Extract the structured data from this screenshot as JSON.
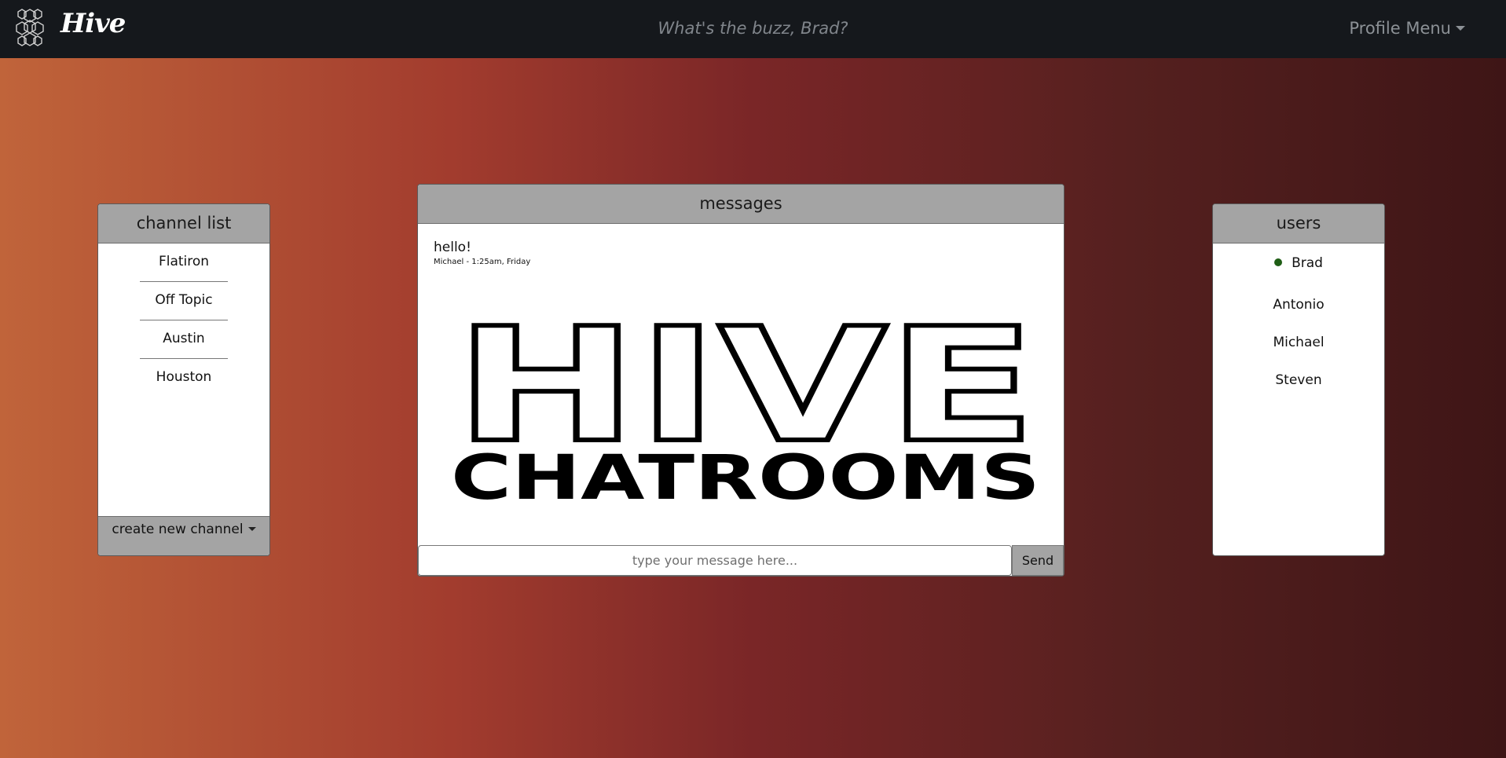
{
  "navbar": {
    "brand": "Hive",
    "tagline": "What's the buzz, Brad?",
    "profile_menu": "Profile Menu"
  },
  "channels": {
    "title": "channel list",
    "items": [
      "Flatiron",
      "Off Topic",
      "Austin",
      "Houston"
    ],
    "create_label": "create new channel"
  },
  "messages": {
    "title": "messages",
    "items": [
      {
        "text": "hello!",
        "meta": "Michael - 1:25am, Friday"
      }
    ],
    "logo": {
      "line1": "HIVE",
      "line2": "CHATROOMS"
    },
    "input_placeholder": "type your message here...",
    "send_label": "Send"
  },
  "users": {
    "title": "users",
    "items": [
      {
        "name": "Brad",
        "online": true
      },
      {
        "name": "Antonio",
        "online": false
      },
      {
        "name": "Michael",
        "online": false
      },
      {
        "name": "Steven",
        "online": false
      }
    ]
  },
  "colors": {
    "navbar_bg": "#15181c",
    "panel_header": "#a4a4a4",
    "online_dot": "#1f5e16",
    "gradient": [
      "#c0643a",
      "#a23c2e",
      "#7a2627",
      "#55201f",
      "#3e1516"
    ]
  },
  "icons": {
    "logo": "honeycomb-icon",
    "profile_caret": "caret-down-icon",
    "create_caret": "caret-down-icon",
    "online": "online-dot-icon"
  }
}
